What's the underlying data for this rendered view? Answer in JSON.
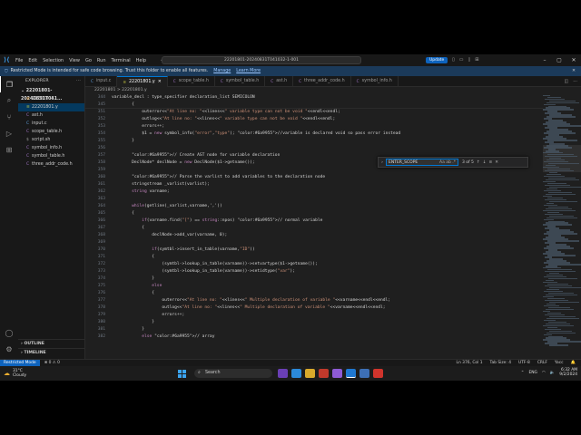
{
  "window": {
    "title": "22201801-20240831T041032-1-001",
    "menu": [
      "File",
      "Edit",
      "Selection",
      "View",
      "Go",
      "Run",
      "Terminal",
      "Help"
    ],
    "update_label": "Update"
  },
  "restricted_banner": {
    "text": "Restricted Mode is intended for safe code browsing. Trust this folder to enable all features.",
    "manage": "Manage",
    "learn_more": "Learn More"
  },
  "sidebar": {
    "header": "EXPLORER",
    "folder": "22201801-20240831T041...",
    "items": [
      {
        "label": "22201801.l",
        "icon": "l",
        "selected": false
      },
      {
        "label": "22201801.y",
        "icon": "y",
        "selected": true
      },
      {
        "label": "ast.h",
        "icon": "h",
        "selected": false
      },
      {
        "label": "input.c",
        "icon": "c",
        "selected": false
      },
      {
        "label": "scope_table.h",
        "icon": "h",
        "selected": false
      },
      {
        "label": "script.sh",
        "icon": "o",
        "selected": false
      },
      {
        "label": "symbol_info.h",
        "icon": "h",
        "selected": false
      },
      {
        "label": "symbol_table.h",
        "icon": "h",
        "selected": false
      },
      {
        "label": "three_addr_code.h",
        "icon": "h",
        "selected": false
      }
    ],
    "outline": "OUTLINE",
    "timeline": "TIMELINE"
  },
  "tabs": [
    {
      "label": "input.c",
      "icon": "c",
      "active": false
    },
    {
      "label": "22201801.y",
      "icon": "y",
      "active": true
    },
    {
      "label": "scope_table.h",
      "icon": "h",
      "active": false
    },
    {
      "label": "symbol_table.h",
      "icon": "h",
      "active": false
    },
    {
      "label": "ast.h",
      "icon": "h",
      "active": false
    },
    {
      "label": "three_addr_code.h",
      "icon": "h",
      "active": false
    },
    {
      "label": "symbol_info.h",
      "icon": "h",
      "active": false
    }
  ],
  "breadcrumb": "22201801 > 22201801.y",
  "sticky": [
    {
      "ln": "344",
      "text": "variable_decl : type_specifier declaration_list SEMICOLON"
    },
    {
      "ln": "345",
      "text": "        {"
    }
  ],
  "code": [
    {
      "ln": "351",
      "text": "            outerror<<\"At line no: \"<<lines<<\" variable type can not be void \"<<endl<<endl;"
    },
    {
      "ln": "352",
      "text": "            outlog<<\"At line no: \"<<lines<<\" variable type can not be void \"<<endl<<endl;"
    },
    {
      "ln": "353",
      "text": "            errors++;"
    },
    {
      "ln": "354",
      "text": "            $1 = new symbol_info(\"error\",\"type\"); //variable is declared void so pass error instead"
    },
    {
      "ln": "355",
      "text": "        }"
    },
    {
      "ln": "356",
      "text": ""
    },
    {
      "ln": "357",
      "text": "        // Create AST node for variable declaration"
    },
    {
      "ln": "358",
      "text": "        DeclNode* declNode = new DeclNode($1->getname());"
    },
    {
      "ln": "359",
      "text": ""
    },
    {
      "ln": "360",
      "text": "        // Parse the varlist to add variables to the declaration node"
    },
    {
      "ln": "361",
      "text": "        stringstream _varlist(varlist);"
    },
    {
      "ln": "362",
      "text": "        string varname;"
    },
    {
      "ln": "363",
      "text": ""
    },
    {
      "ln": "364",
      "text": "        while(getline(_varlist,varname,','))"
    },
    {
      "ln": "365",
      "text": "        {"
    },
    {
      "ln": "366",
      "text": "            if(varname.find(\"[\") == string::npos) // normal variable"
    },
    {
      "ln": "367",
      "text": "            {"
    },
    {
      "ln": "368",
      "text": "                declNode->add_var(varname, 0);"
    },
    {
      "ln": "369",
      "text": ""
    },
    {
      "ln": "370",
      "text": "                if(symtbl->insert_in_table(varname,\"ID\"))"
    },
    {
      "ln": "371",
      "text": "                {"
    },
    {
      "ln": "372",
      "text": "                    (symtbl->lookup_in_table(varname))->setvartype($1->getname());"
    },
    {
      "ln": "373",
      "text": "                    (symtbl->lookup_in_table(varname))->setidtype(\"var\");"
    },
    {
      "ln": "374",
      "text": "                }"
    },
    {
      "ln": "375",
      "text": "                else"
    },
    {
      "ln": "376",
      "text": "                {"
    },
    {
      "ln": "377",
      "text": "                    outerror<<\"At line no: \"<<lines<<\" Multiple declaration of variable \"<<varname<<endl<<endl;"
    },
    {
      "ln": "378",
      "text": "                    outlog<<\"At line no: \"<<lines<<\" Multiple declaration of variable \"<<varname<<endl<<endl;"
    },
    {
      "ln": "379",
      "text": "                    errors++;"
    },
    {
      "ln": "380",
      "text": "                }"
    },
    {
      "ln": "381",
      "text": "            }"
    },
    {
      "ln": "382",
      "text": "            else // array"
    }
  ],
  "find": {
    "query": "ENTER_SCOPE",
    "options": "Aa ab .*",
    "count": "3 of 5"
  },
  "status": {
    "restricted": "Restricted Mode",
    "errors": "⊗ 0  ⚠ 0",
    "position": "Ln 376, Col 1",
    "tab_size": "Tab Size: 4",
    "encoding": "UTF-8",
    "eol": "CRLF",
    "language": "Yacc",
    "notif": "🔔"
  },
  "taskbar": {
    "temp": "31°C",
    "weather": "Cloudy",
    "search": "Search",
    "language": "ENG",
    "time": "6:32 AM",
    "date": "9/2/2024"
  },
  "colors": {
    "accent": "#0078d4",
    "restricted": "#0e63bd",
    "keyword": "#c586c0",
    "string": "#ce9178",
    "comment": "#6a9955"
  }
}
